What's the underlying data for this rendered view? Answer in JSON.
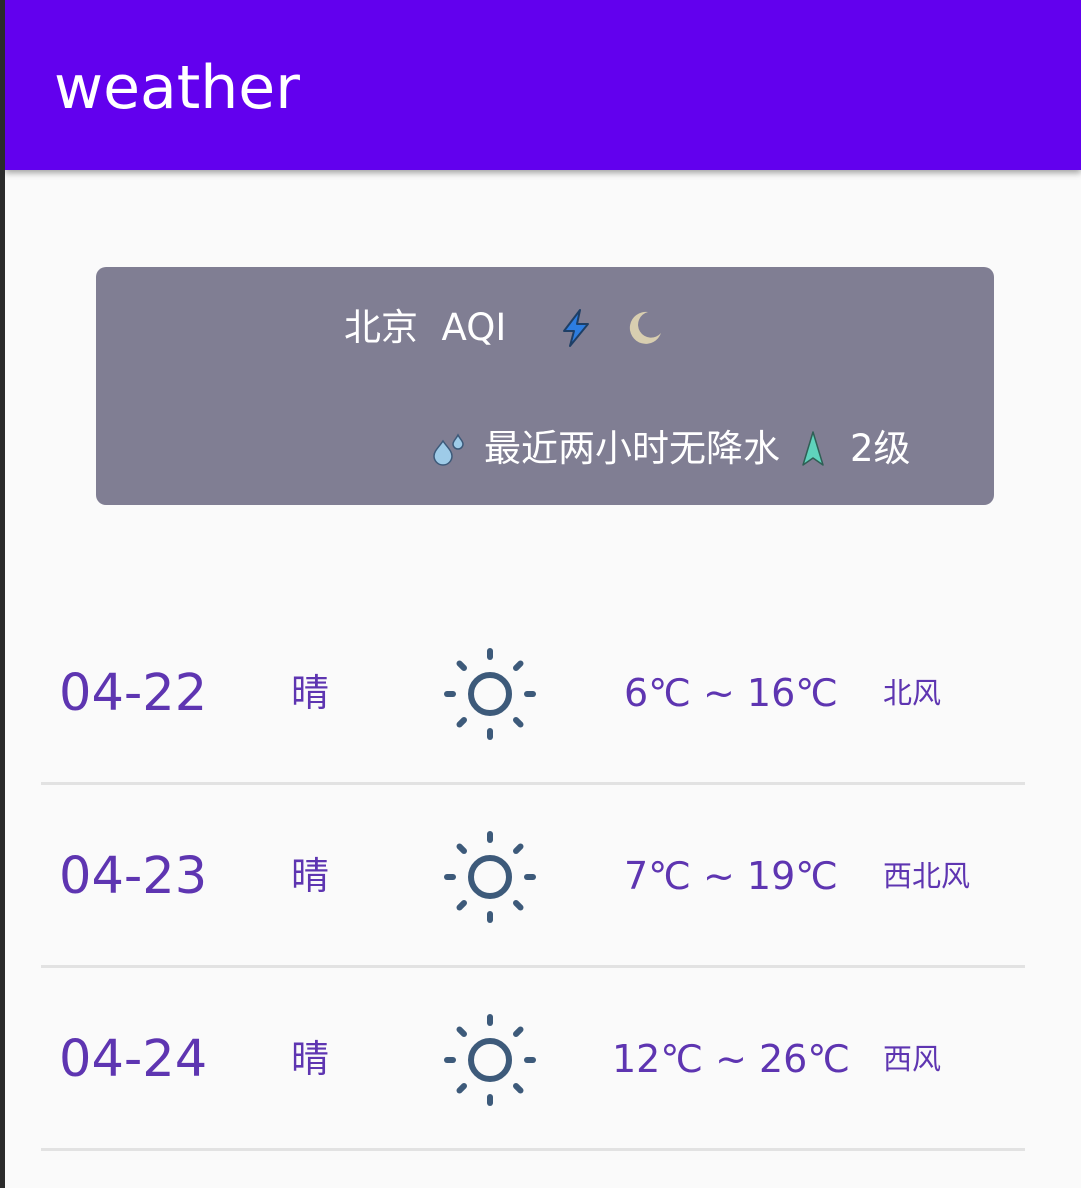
{
  "appbar": {
    "title": "weather",
    "color": "#6200ee"
  },
  "now": {
    "city": "北京",
    "aqi_label": "AQI",
    "weather_icon": "lightning-icon",
    "time_icon": "crescent-moon-icon",
    "precip_icon": "raindrops-icon",
    "precip_text": "最近两小时无降水",
    "wind_icon": "wind-direction-arrow-icon",
    "wind_level": "2级",
    "card_color": "#807e93"
  },
  "forecast": [
    {
      "date": "04-22",
      "condition": "晴",
      "icon": "sun-icon",
      "temp": "6℃ ~ 16℃",
      "wind": "北风"
    },
    {
      "date": "04-23",
      "condition": "晴",
      "icon": "sun-icon",
      "temp": "7℃ ~ 19℃",
      "wind": "西北风"
    },
    {
      "date": "04-24",
      "condition": "晴",
      "icon": "sun-icon",
      "temp": "12℃ ~ 26℃",
      "wind": "西风"
    }
  ],
  "colors": {
    "accent_text": "#5e35b1",
    "sun_icon": "#3d5a7a",
    "lightning": "#2d7de0",
    "moon": "#d8ceb0",
    "wind_arrow": "#5fd3bc",
    "raindrop": "#9ecbe8"
  }
}
